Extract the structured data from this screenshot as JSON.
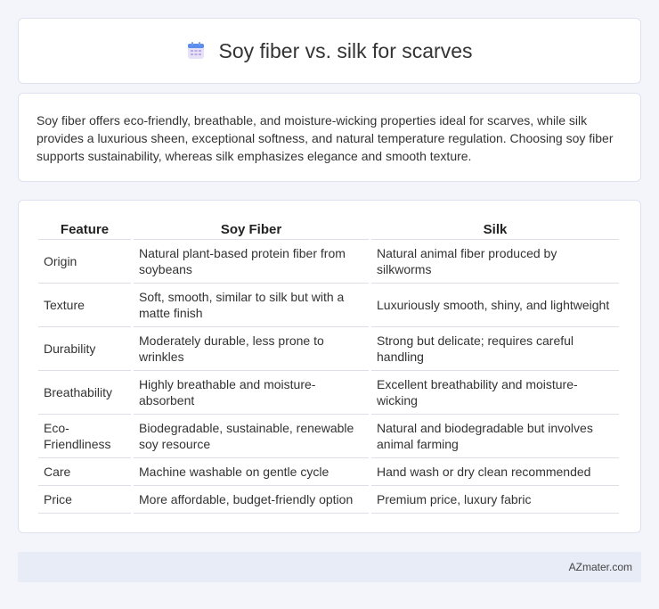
{
  "header": {
    "title": "Soy fiber vs. silk for scarves",
    "icon": "calendar-icon"
  },
  "summary": {
    "text": "Soy fiber offers eco-friendly, breathable, and moisture-wicking properties ideal for scarves, while silk provides a luxurious sheen, exceptional softness, and natural temperature regulation. Choosing soy fiber supports sustainability, whereas silk emphasizes elegance and smooth texture."
  },
  "table": {
    "headers": [
      "Feature",
      "Soy Fiber",
      "Silk"
    ],
    "rows": [
      [
        "Origin",
        "Natural plant-based protein fiber from soybeans",
        "Natural animal fiber produced by silkworms"
      ],
      [
        "Texture",
        "Soft, smooth, similar to silk but with a matte finish",
        "Luxuriously smooth, shiny, and lightweight"
      ],
      [
        "Durability",
        "Moderately durable, less prone to wrinkles",
        "Strong but delicate; requires careful handling"
      ],
      [
        "Breathability",
        "Highly breathable and moisture-absorbent",
        "Excellent breathability and moisture-wicking"
      ],
      [
        "Eco-Friendliness",
        "Biodegradable, sustainable, renewable soy resource",
        "Natural and biodegradable but involves animal farming"
      ],
      [
        "Care",
        "Machine washable on gentle cycle",
        "Hand wash or dry clean recommended"
      ],
      [
        "Price",
        "More affordable, budget-friendly option",
        "Premium price, luxury fabric"
      ]
    ]
  },
  "footer": {
    "text": "AZmater.com"
  },
  "colors": {
    "background": "#f3f5fa",
    "card": "#ffffff",
    "footer": "#e8ecf6",
    "icon_top": "#5b8def",
    "icon_body": "#e6e1f7"
  }
}
